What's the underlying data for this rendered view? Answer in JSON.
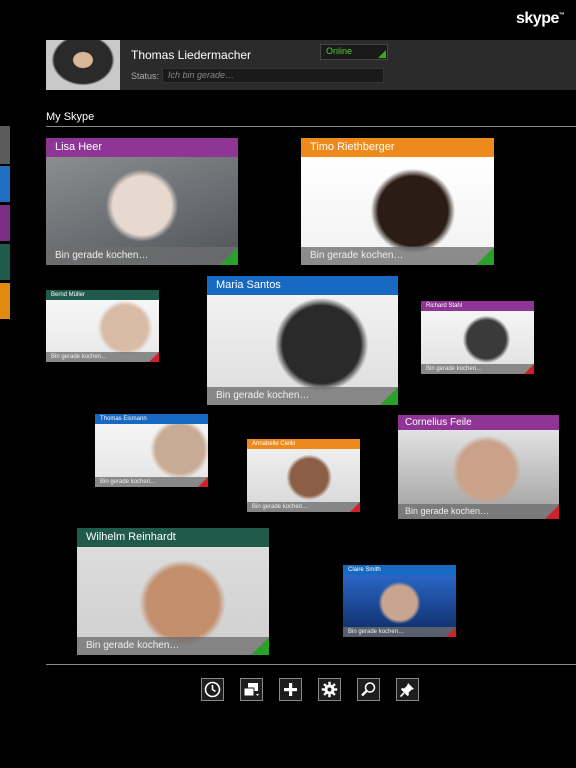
{
  "app": {
    "logo_text": "skype"
  },
  "profile": {
    "name": "Thomas Liedermacher",
    "presence": "Online",
    "status_label": "Status:",
    "status_placeholder": "Ich bin gerade…"
  },
  "section": {
    "title": "My Skype"
  },
  "side_tabs": [
    {
      "color": "#5a5a5a"
    },
    {
      "color": "#1e6fbf"
    },
    {
      "color": "#7b2d86"
    },
    {
      "color": "#1f5a4a"
    },
    {
      "color": "#e08a12"
    }
  ],
  "contacts": [
    {
      "name": "Lisa Heer",
      "status": "Bin gerade kochen…",
      "header_color": "#8e3596",
      "presence_color": "#2aa12a"
    },
    {
      "name": "Timo Riethberger",
      "status": "Bin gerade kochen…",
      "header_color": "#ee8a1c",
      "presence_color": "#2aa12a"
    },
    {
      "name": "Bernd Müller",
      "status": "Bin gerade kochen…",
      "header_color": "#1f5a4a",
      "presence_color": "#d0202a"
    },
    {
      "name": "Maria Santos",
      "status": "Bin gerade kochen…",
      "header_color": "#1769c2",
      "presence_color": "#2aa12a"
    },
    {
      "name": "Richard Stahl",
      "status": "Bin gerade kochen…",
      "header_color": "#8e3596",
      "presence_color": "#d0202a"
    },
    {
      "name": "Thomas Eismann",
      "status": "Bin gerade kochen…",
      "header_color": "#1769c2",
      "presence_color": "#d0202a"
    },
    {
      "name": "Annabelle Ciello",
      "status": "Bin gerade kochen…",
      "header_color": "#ee8a1c",
      "presence_color": "#d0202a"
    },
    {
      "name": "Cornelius Feile",
      "status": "Bin gerade kochen…",
      "header_color": "#8e3596",
      "presence_color": "#d0202a"
    },
    {
      "name": "Wilhelm Reinhardt",
      "status": "Bin gerade kochen…",
      "header_color": "#1f5a4a",
      "presence_color": "#2aa12a"
    },
    {
      "name": "Claire Smith",
      "status": "Bin gerade kochen…",
      "header_color": "#1769c2",
      "presence_color": "#d0202a"
    }
  ],
  "toolbar": [
    {
      "icon": "clock-icon",
      "label": "history"
    },
    {
      "icon": "windows-icon",
      "label": "switch-view"
    },
    {
      "icon": "plus-icon",
      "label": "add-contact"
    },
    {
      "icon": "gear-icon",
      "label": "settings"
    },
    {
      "icon": "search-icon",
      "label": "search"
    },
    {
      "icon": "pin-icon",
      "label": "pin"
    }
  ]
}
